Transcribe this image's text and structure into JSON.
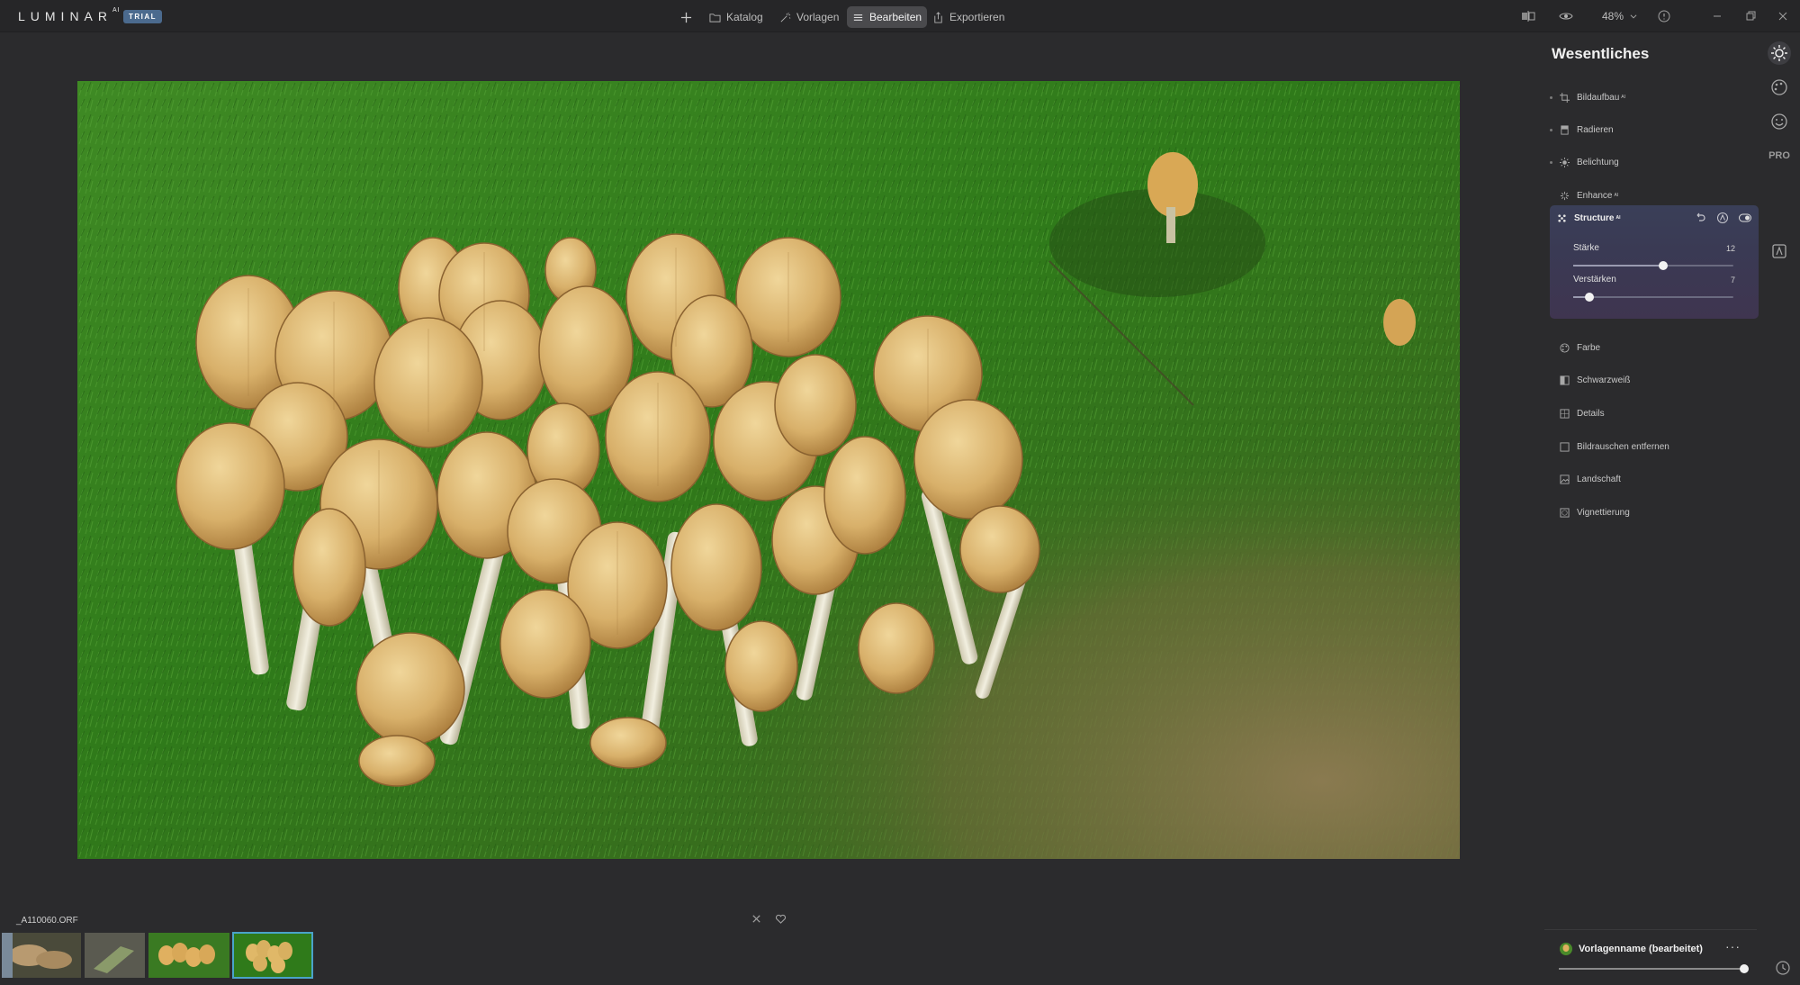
{
  "app": {
    "logo": "LUMINAR",
    "logo_sup": "AI",
    "badge": "TRIAL"
  },
  "topnav": {
    "katalog": "Katalog",
    "vorlagen": "Vorlagen",
    "bearbeiten": "Bearbeiten",
    "exportieren": "Exportieren",
    "active": "Bearbeiten"
  },
  "toolbar": {
    "zoom": "48%"
  },
  "panel": {
    "title": "Wesentliches",
    "tools_top": [
      {
        "label": "Bildaufbau",
        "sup": "AI",
        "icon": "crop-icon"
      },
      {
        "label": "Radieren",
        "sup": "",
        "icon": "eraser-icon"
      },
      {
        "label": "Belichtung",
        "sup": "",
        "icon": "sun-icon"
      },
      {
        "label": "Enhance",
        "sup": "AI",
        "icon": "sparkle-icon"
      }
    ],
    "structure": {
      "title": "Structure",
      "sup": "AI",
      "sliders": [
        {
          "label": "Stärke",
          "value": "12",
          "position": 0.56
        },
        {
          "label": "Verstärken",
          "value": "7",
          "position": 0.1
        }
      ]
    },
    "tools_bottom": [
      {
        "label": "Farbe",
        "icon": "palette-icon"
      },
      {
        "label": "Schwarzweiß",
        "icon": "bw-icon"
      },
      {
        "label": "Details",
        "icon": "details-icon"
      },
      {
        "label": "Bildrauschen entfernen",
        "icon": "denoise-icon"
      },
      {
        "label": "Landschaft",
        "icon": "landscape-icon"
      },
      {
        "label": "Vignettierung",
        "icon": "vignette-icon"
      }
    ]
  },
  "sidebar_icons": {
    "pro_label": "PRO"
  },
  "filmstrip": {
    "filename": "_A110060.ORF"
  },
  "preset": {
    "name": "Vorlagenname (bearbeitet)",
    "more": "···",
    "amount": 0.98
  },
  "colors": {
    "accent_selected": "#4aa3c9",
    "card_bg": "#3a3f58",
    "badge": "#4b6a8e"
  }
}
